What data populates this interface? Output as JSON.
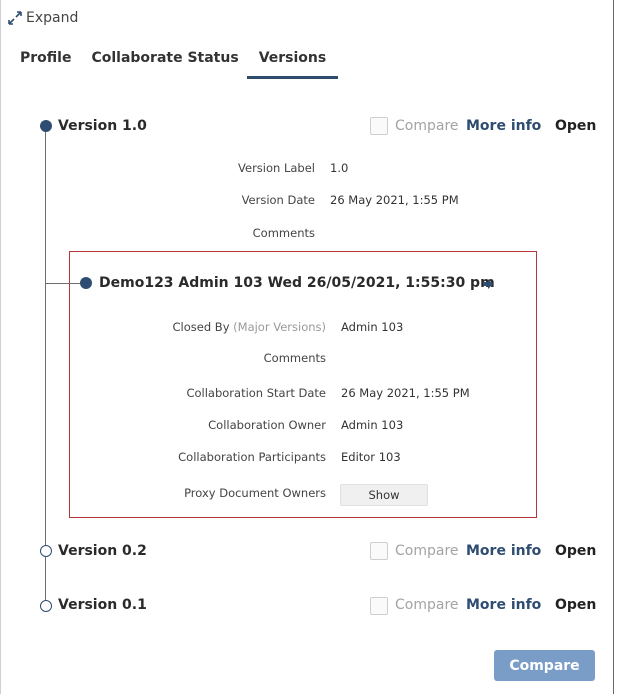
{
  "expand_label": "Expand",
  "tabs": [
    {
      "label": "Profile"
    },
    {
      "label": "Collaborate Status"
    },
    {
      "label": "Versions"
    }
  ],
  "versions": [
    {
      "title": "Version 1.0",
      "compare_label": "Compare",
      "more_info_label": "More info",
      "open_label": "Open",
      "details": [
        {
          "label": "Version Label",
          "value": "1.0"
        },
        {
          "label": "Version Date",
          "value": "26 May 2021, 1:55 PM"
        },
        {
          "label": "Comments",
          "value": ""
        }
      ]
    },
    {
      "title": "Version 0.2",
      "compare_label": "Compare",
      "more_info_label": "More info",
      "open_label": "Open"
    },
    {
      "title": "Version 0.1",
      "compare_label": "Compare",
      "more_info_label": "More info",
      "open_label": "Open"
    }
  ],
  "collaboration": {
    "title": "Demo123 Admin 103 Wed 26/05/2021, 1:55:30 pm",
    "closed_by_label": "Closed By",
    "closed_by_note": "(Major Versions)",
    "closed_by_value": "Admin 103",
    "comments_label": "Comments",
    "comments_value": "",
    "start_date_label": "Collaboration Start Date",
    "start_date_value": "26 May 2021, 1:55 PM",
    "owner_label": "Collaboration Owner",
    "owner_value": "Admin 103",
    "participants_label": "Collaboration Participants",
    "participants_value": "Editor 103",
    "proxy_owners_label": "Proxy Document Owners",
    "show_label": "Show"
  },
  "compare_button_label": "Compare",
  "colors": {
    "accent": "#2f4d72",
    "box_border": "#b8333a",
    "compare_button": "#7a9dc8"
  }
}
